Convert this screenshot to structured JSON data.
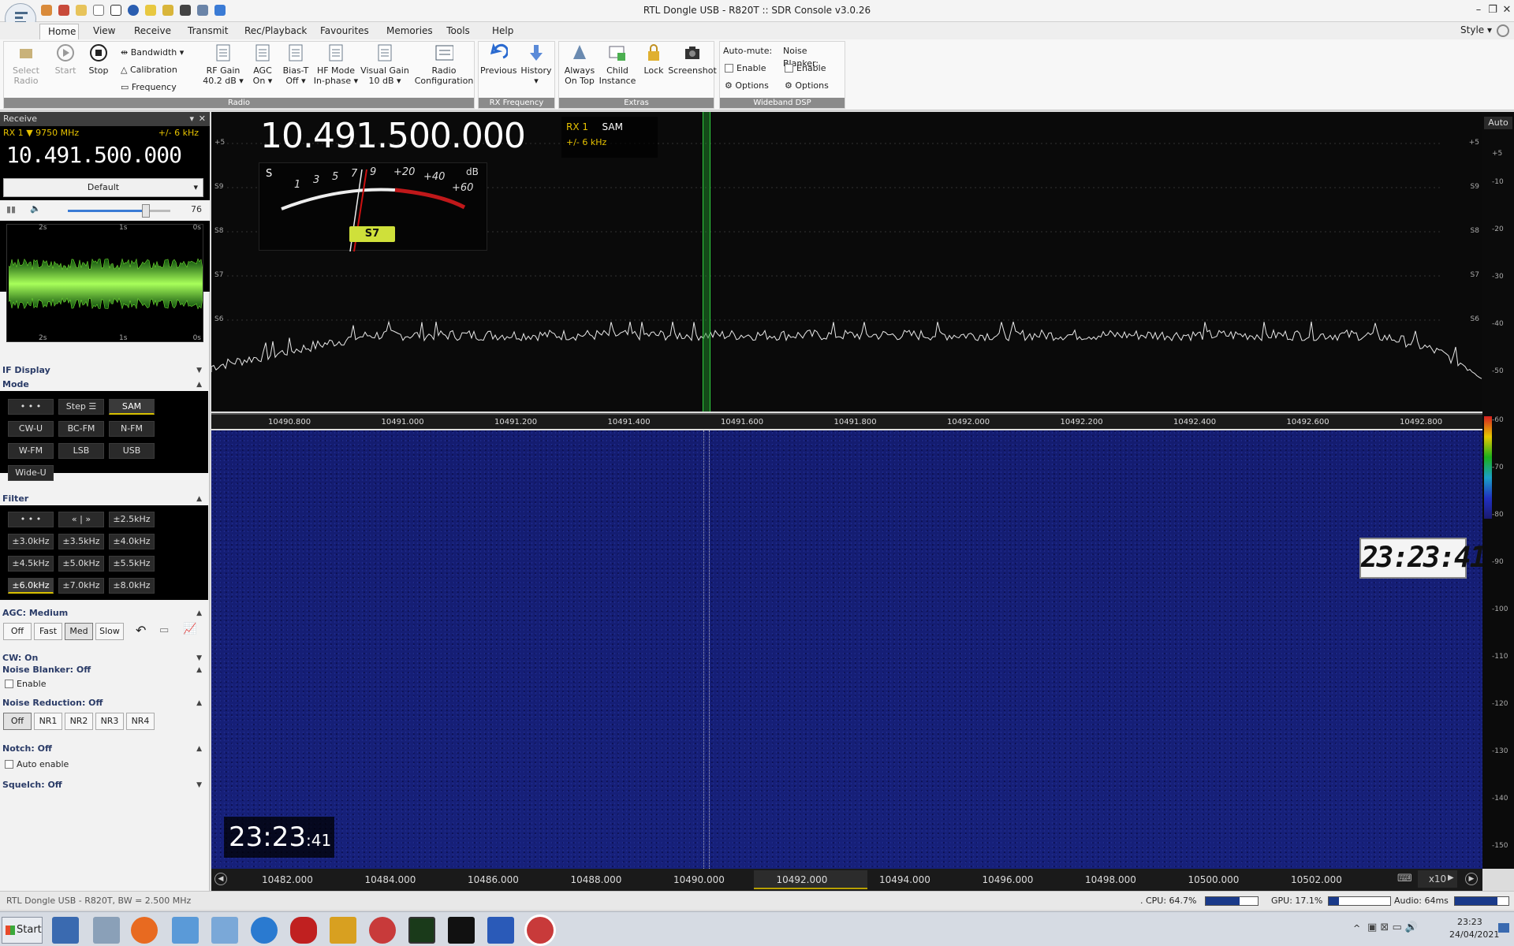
{
  "window": {
    "title": "RTL Dongle USB - R820T :: SDR Console v3.0.26",
    "style_label": "Style"
  },
  "tabs": [
    "Home",
    "View",
    "Receive",
    "Transmit",
    "Rec/Playback",
    "Favourites",
    "Memories",
    "Tools",
    "Help"
  ],
  "ribbon": {
    "radio": {
      "group": "Radio",
      "select_radio": "Select Radio",
      "start": "Start",
      "stop": "Stop",
      "bandwidth": "Bandwidth",
      "calibration": "Calibration",
      "frequency": "Frequency",
      "rf_gain": "RF Gain",
      "rf_gain_val": "40.2 dB",
      "agc": "AGC",
      "agc_val": "On",
      "bias_t": "Bias-T",
      "bias_t_val": "Off",
      "hf_mode": "HF Mode",
      "hf_mode_val": "In-phase",
      "visual_gain": "Visual Gain",
      "visual_gain_val": "10 dB",
      "radio_config": "Radio Configuration"
    },
    "rx_freq": {
      "group": "RX Frequency",
      "previous": "Previous",
      "history": "History"
    },
    "extras": {
      "group": "Extras",
      "always_on_top": "Always On Top",
      "child_instance": "Child Instance",
      "lock": "Lock",
      "screenshot": "Screenshot"
    },
    "wideband": {
      "group": "Wideband DSP",
      "auto_mute": "Auto-mute:",
      "noise_blanker": "Noise Blanker:",
      "enable": "Enable",
      "options": "Options"
    }
  },
  "receive": {
    "header": "Receive",
    "rx_label": "RX 1",
    "lo": "9750 MHz",
    "filter_bw": "+/- 6 kHz",
    "frequency": "10.491.500.000",
    "preset": "Default",
    "volume": "76",
    "vol_level": 0.76,
    "time_labels": [
      "2s",
      "1s",
      "0s"
    ]
  },
  "sections": {
    "if_display": "IF Display",
    "mode": "Mode",
    "filter": "Filter",
    "agc": "AGC: Medium",
    "cw": "CW: On",
    "nb": "Noise Blanker: Off",
    "nr": "Noise Reduction: Off",
    "notch": "Notch: Off",
    "squelch": "Squelch: Off",
    "enable": "Enable",
    "auto_enable": "Auto enable"
  },
  "modes": [
    "• • •",
    "Step ☰",
    "SAM",
    "CW-U",
    "BC-FM",
    "N-FM",
    "W-FM",
    "LSB",
    "USB",
    "Wide-U"
  ],
  "mode_selected": "SAM",
  "filters": [
    "• • •",
    "« | »",
    "±2.5kHz",
    "±3.0kHz",
    "±3.5kHz",
    "±4.0kHz",
    "±4.5kHz",
    "±5.0kHz",
    "±5.5kHz",
    "±6.0kHz",
    "±7.0kHz",
    "±8.0kHz"
  ],
  "filter_selected": "±6.0kHz",
  "agc_buttons": [
    "Off",
    "Fast",
    "Med",
    "Slow"
  ],
  "agc_selected": "Med",
  "nr_buttons": [
    "Off",
    "NR1",
    "NR2",
    "NR3",
    "NR4"
  ],
  "nr_selected": "Off",
  "spectrum": {
    "frequency": "10.491.500.000",
    "rx": "RX 1",
    "mode": "SAM",
    "bw": "+/- 6 kHz",
    "smeter_reading": "S7",
    "smeter_scale": [
      "S",
      "1",
      "3",
      "5",
      "7",
      "9",
      "+20",
      "+40",
      "+60",
      "dB"
    ],
    "s_labels": [
      "+5",
      "S9",
      "S8",
      "S7",
      "S6"
    ],
    "db_labels": [
      "+5",
      "-10",
      "-20",
      "-30",
      "-40",
      "-50"
    ],
    "auto_label": "Auto",
    "freq_ticks": [
      "10490.800",
      "10491.000",
      "10491.200",
      "10491.400",
      "10491.600",
      "10491.800",
      "10492.000",
      "10492.200",
      "10492.400",
      "10492.600",
      "10492.800"
    ]
  },
  "waterfall": {
    "clock_big": "23:23:41",
    "clock_hhmm": "23:23",
    "clock_ss": ":41",
    "right_scale": [
      "-60",
      "-70",
      "-80",
      "-90",
      "-100",
      "-110",
      "-120",
      "-130",
      "-140",
      "-150"
    ],
    "freq_ticks": [
      "10482.000",
      "10484.000",
      "10486.000",
      "10488.000",
      "10490.000",
      "10492.000",
      "10494.000",
      "10496.000",
      "10498.000",
      "10500.000",
      "10502.000"
    ],
    "zoom": "x10"
  },
  "status": {
    "device": "RTL Dongle USB - R820T, BW = 2.500 MHz",
    "cpu": ". CPU: 64.7%",
    "cpu_level": 0.647,
    "gpu": "GPU: 17.1%",
    "gpu_level": 0.171,
    "audio": "Audio: 64ms",
    "audio_level": 0.8
  },
  "taskbar": {
    "start": "Start",
    "time": "23:23",
    "date": "24/04/2021"
  }
}
